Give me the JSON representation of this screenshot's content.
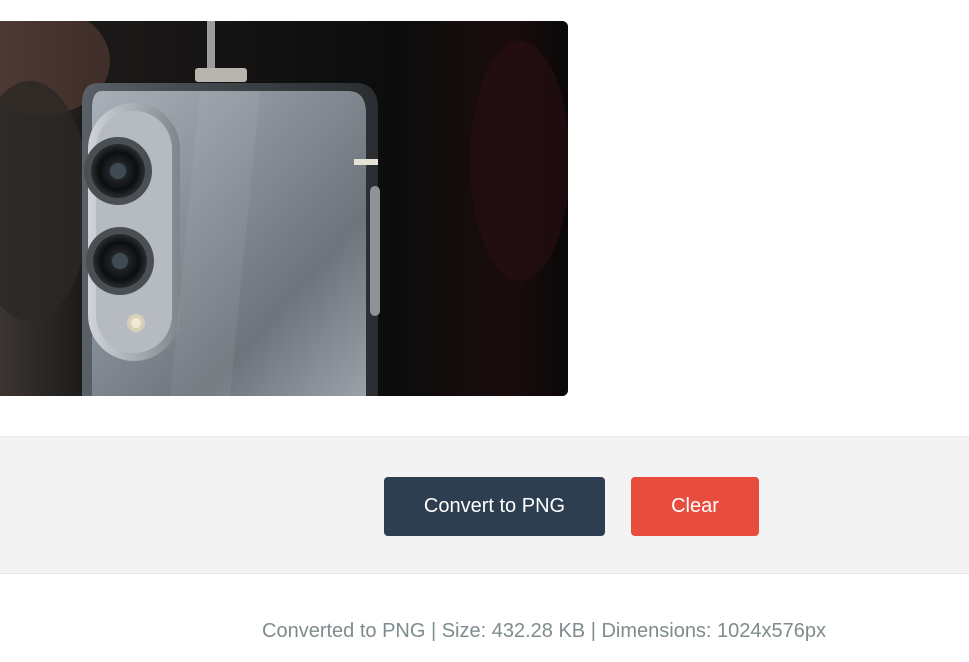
{
  "preview": {
    "image_alt": "Converted image preview: grey smartphone with dual rear camera"
  },
  "actions": {
    "convert_label": "Convert to PNG",
    "clear_label": "Clear"
  },
  "status": {
    "text": "Converted to PNG | Size: 432.28 KB | Dimensions: 1024x576px"
  },
  "colors": {
    "convert_button": "#2c3e50",
    "clear_button": "#e74c3c",
    "status_text": "#7f8c8d",
    "action_bar_bg": "#f3f3f3"
  }
}
